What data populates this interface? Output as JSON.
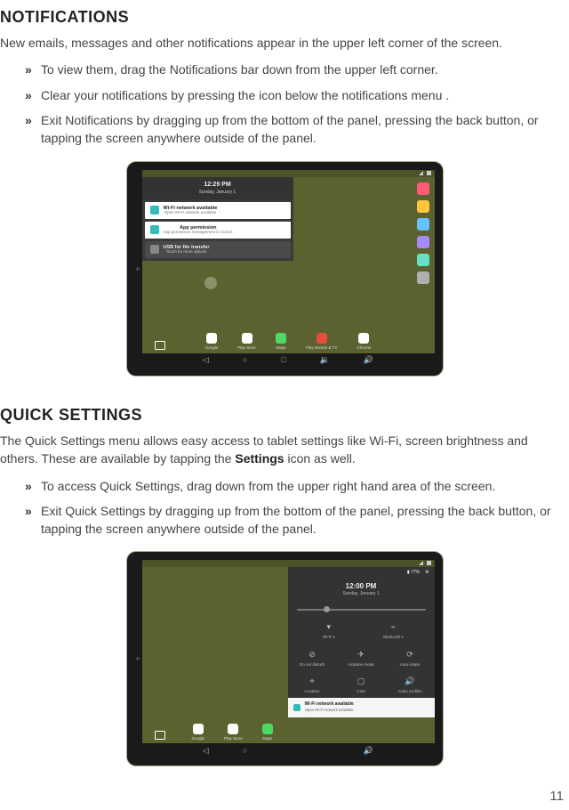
{
  "notifications": {
    "heading": "NOTIFICATIONS",
    "intro": "New emails, messages and other notifications appear in the upper left corner of the screen.",
    "bullets": [
      "To view them, drag the Notifications bar down from the upper left corner.",
      "Clear your notifications by pressing the icon below the notifications menu .",
      "Exit Notifications by dragging up from the bottom of the panel, pressing the back button, or tapping the screen anywhere outside of the panel."
    ],
    "screenshot": {
      "time": "12:29 PM",
      "date": "Sunday, January 1",
      "cards": [
        {
          "title": "Wi-Fi network available",
          "sub": "Open Wi-Fi network available"
        },
        {
          "title": "App permission",
          "sub": "App permission management is closed."
        },
        {
          "title": "USB for file transfer",
          "sub": "Touch for more options"
        }
      ],
      "apps": [
        {
          "label": "Google",
          "color": "#ffffff"
        },
        {
          "label": "Play Store",
          "color": "#ffffff"
        },
        {
          "label": "Maps",
          "color": "#4cd964"
        },
        {
          "label": "Play Movies & TV",
          "color": "#e74c3c"
        },
        {
          "label": "Chrome",
          "color": "#ffffff"
        }
      ],
      "side_widgets": [
        "#ff5b77",
        "#ffc53d",
        "#66c2ff",
        "#a58aff",
        "#66e0c2",
        "#b0b0b0"
      ]
    }
  },
  "quick": {
    "heading": "QUICK SETTINGS",
    "intro_pre": "The Quick Settings menu allows easy access to tablet settings like Wi-Fi, screen brightness and others. These are available by tapping the ",
    "intro_bold": "Settings",
    "intro_post": " icon as well.",
    "bullets": [
      "To access Quick Settings, drag down from the upper right hand area of the screen.",
      "Exit Quick Settings by dragging up from the bottom of the panel, pressing the back button, or tapping the screen anywhere outside of the panel."
    ],
    "screenshot": {
      "battery": "77%",
      "time": "12:00 PM",
      "date": "Sunday, January 1",
      "tiles_row1": [
        {
          "label": "Wi-Fi",
          "icon": "wifi"
        },
        {
          "label": "Bluetooth",
          "icon": "bt"
        }
      ],
      "tiles_row2": [
        {
          "label": "Do not disturb",
          "icon": "dnd"
        },
        {
          "label": "Airplane mode",
          "icon": "plane"
        },
        {
          "label": "Auto-rotate",
          "icon": "rotate"
        }
      ],
      "tiles_row3": [
        {
          "label": "Location",
          "icon": "loc"
        },
        {
          "label": "Cast",
          "icon": "cast"
        },
        {
          "label": "Audio profiles",
          "icon": "audio"
        }
      ],
      "notif": {
        "title": "Wi-Fi network available",
        "sub": "Open Wi-Fi network available"
      },
      "apps": [
        {
          "label": "Google",
          "color": "#ffffff"
        },
        {
          "label": "Play Store",
          "color": "#ffffff"
        },
        {
          "label": "Maps",
          "color": "#4cd964"
        }
      ],
      "side_widgets": [
        "#ff5b77",
        "#ffc53d",
        "#66c2ff",
        "#a58aff",
        "#66e0c2",
        "#b0b0b0"
      ]
    }
  },
  "page_number": "11"
}
